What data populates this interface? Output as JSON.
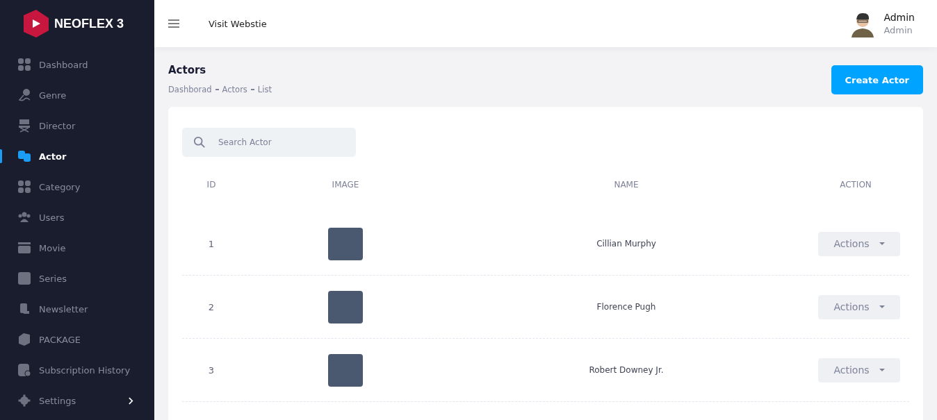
{
  "brand": {
    "name": "NEOFLEX 3"
  },
  "sidebar": {
    "items": [
      {
        "label": "Dashboard",
        "selected": false
      },
      {
        "label": "Genre",
        "selected": false
      },
      {
        "label": "Director",
        "selected": false
      },
      {
        "label": "Actor",
        "selected": true
      },
      {
        "label": "Category",
        "selected": false
      },
      {
        "label": "Users",
        "selected": false
      },
      {
        "label": "Movie",
        "selected": false
      },
      {
        "label": "Series",
        "selected": false
      },
      {
        "label": "Newsletter",
        "selected": false
      },
      {
        "label": "PACKAGE",
        "selected": false
      },
      {
        "label": "Subscription History",
        "selected": false
      },
      {
        "label": "Settings",
        "selected": false,
        "expandable": true
      }
    ]
  },
  "header": {
    "link": "Visit Webstie",
    "user": {
      "name": "Admin",
      "role": "Admin"
    }
  },
  "page": {
    "title": "Actors",
    "breadcrumb": [
      "Dashborad",
      "Actors",
      "List"
    ],
    "create_button": "Create Actor"
  },
  "search": {
    "placeholder": "Search Actor"
  },
  "table": {
    "columns": [
      "ID",
      "IMAGE",
      "NAME",
      "ACTION"
    ],
    "rows": [
      {
        "id": "1",
        "name": "Cillian Murphy",
        "action": "Actions"
      },
      {
        "id": "2",
        "name": "Florence Pugh",
        "action": "Actions"
      },
      {
        "id": "3",
        "name": "Robert Downey Jr.",
        "action": "Actions"
      }
    ]
  }
}
